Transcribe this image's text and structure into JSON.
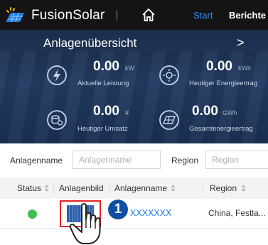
{
  "header": {
    "brand": "FusionSolar",
    "nav_start": "Start",
    "nav_reports": "Berichte",
    "colors": {
      "bar": "#141414",
      "accent": "#2f8cff"
    }
  },
  "overview": {
    "title": "Anlagenübersicht",
    "metrics": [
      {
        "value": "0.00",
        "unit": "kW",
        "label": "Aktuelle Leistung",
        "icon": "lightning-icon"
      },
      {
        "value": "0.00",
        "unit": "kWh",
        "label": "Heutiger Energieertrag",
        "icon": "sun-panel-icon"
      },
      {
        "value": "0.00",
        "unit": "¥",
        "label": "Heutiger Umsatz",
        "icon": "coins-icon"
      },
      {
        "value": "0.00",
        "unit": "GWh",
        "label": "Gesamtenergieertrag",
        "icon": "panel-total-icon"
      }
    ]
  },
  "filters": {
    "plant_name_label": "Anlagenname",
    "plant_name_placeholder": "Anlagenname",
    "region_label": "Region",
    "region_placeholder": "Region"
  },
  "table": {
    "columns": [
      "Status",
      "Anlagenbild",
      "Anlagenname",
      "Region"
    ],
    "rows": [
      {
        "status": "online",
        "plant_name": "XXXXXXX",
        "region": "China, Festla..."
      }
    ],
    "status_color": "#3fbf4f"
  },
  "callout": {
    "step": "1"
  }
}
